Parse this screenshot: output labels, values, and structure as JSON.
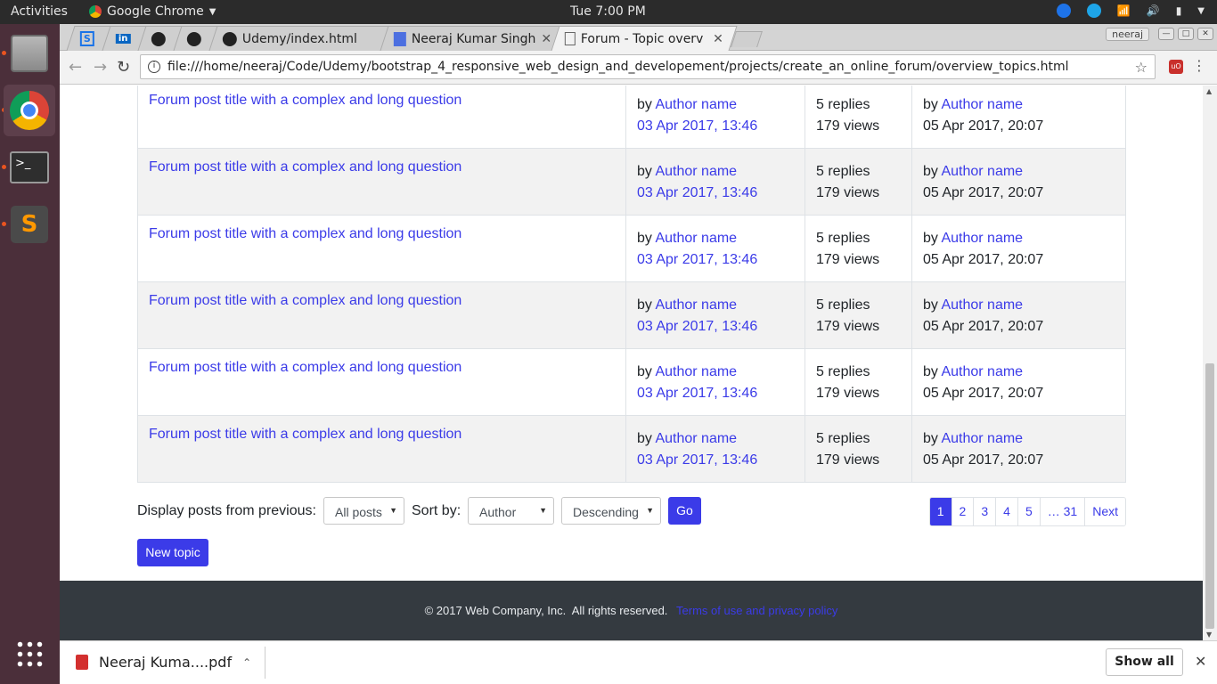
{
  "topbar": {
    "activities": "Activities",
    "app_name": "Google Chrome",
    "clock": "Tue  7:00 PM"
  },
  "dock": {
    "apps": [
      "files-app",
      "chrome-app",
      "terminal-app",
      "sublime-app"
    ],
    "show_apps": "app-grid"
  },
  "tabs": [
    {
      "label": "",
      "icon": "s-icon"
    },
    {
      "label": "",
      "icon": "linkedin-icon"
    },
    {
      "label": "",
      "icon": "github-icon"
    },
    {
      "label": "",
      "icon": "github-icon"
    },
    {
      "label": "Udemy/index.html",
      "icon": "github-icon"
    },
    {
      "label": "Neeraj Kumar Singh",
      "icon": "doc-icon"
    },
    {
      "label": "Forum - Topic overv",
      "icon": "page-icon"
    }
  ],
  "user_label": "neeraj",
  "url": "file:///home/neeraj/Code/Udemy/bootstrap_4_responsive_web_design_and_developement/projects/create_an_online_forum/overview_topics.html",
  "rows": [
    {
      "title": "Forum post title with a complex and long question",
      "by": "by",
      "author": "Author name",
      "date": "03 Apr 2017, 13:46",
      "replies": "5 replies",
      "views": "179 views",
      "last_by": "by",
      "last_author": "Author name",
      "last_date": "05 Apr 2017, 20:07"
    },
    {
      "title": "Forum post title with a complex and long question",
      "by": "by",
      "author": "Author name",
      "date": "03 Apr 2017, 13:46",
      "replies": "5 replies",
      "views": "179 views",
      "last_by": "by",
      "last_author": "Author name",
      "last_date": "05 Apr 2017, 20:07"
    },
    {
      "title": "Forum post title with a complex and long question",
      "by": "by",
      "author": "Author name",
      "date": "03 Apr 2017, 13:46",
      "replies": "5 replies",
      "views": "179 views",
      "last_by": "by",
      "last_author": "Author name",
      "last_date": "05 Apr 2017, 20:07"
    },
    {
      "title": "Forum post title with a complex and long question",
      "by": "by",
      "author": "Author name",
      "date": "03 Apr 2017, 13:46",
      "replies": "5 replies",
      "views": "179 views",
      "last_by": "by",
      "last_author": "Author name",
      "last_date": "05 Apr 2017, 20:07"
    },
    {
      "title": "Forum post title with a complex and long question",
      "by": "by",
      "author": "Author name",
      "date": "03 Apr 2017, 13:46",
      "replies": "5 replies",
      "views": "179 views",
      "last_by": "by",
      "last_author": "Author name",
      "last_date": "05 Apr 2017, 20:07"
    },
    {
      "title": "Forum post title with a complex and long question",
      "by": "by",
      "author": "Author name",
      "date": "03 Apr 2017, 13:46",
      "replies": "5 replies",
      "views": "179 views",
      "last_by": "by",
      "last_author": "Author name",
      "last_date": "05 Apr 2017, 20:07"
    }
  ],
  "controls": {
    "display_label": "Display posts from previous:",
    "display_value": "All posts",
    "sort_label": "Sort by:",
    "sort_value": "Author",
    "order_value": "Descending",
    "go_label": "Go",
    "new_topic": "New topic"
  },
  "pagination": {
    "pages": [
      "1",
      "2",
      "3",
      "4",
      "5",
      "… 31"
    ],
    "current": "1",
    "next": "Next"
  },
  "footer": {
    "copyright": "© 2017 Web Company, Inc.  All rights reserved.",
    "terms": "Terms of use and privacy policy"
  },
  "downloads": {
    "file": "Neeraj Kuma....pdf",
    "show_all": "Show all"
  },
  "colors": {
    "link": "#3b3be8",
    "footer_bg": "#343a40",
    "dock_bg": "#4b2f3a",
    "accent": "#e95420"
  }
}
